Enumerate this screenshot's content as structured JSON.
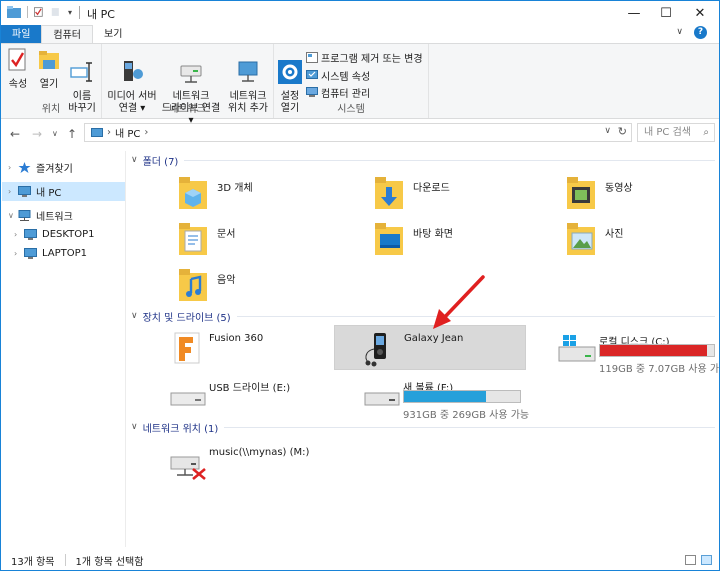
{
  "window": {
    "title": "내 PC",
    "controls": {
      "minimize": "—",
      "maximize": "☐",
      "close": "✕"
    }
  },
  "ribbon_tabs": [
    "파일",
    "컴퓨터",
    "보기"
  ],
  "ribbon_toggle": "∨",
  "help": "?",
  "ribbon": {
    "location": {
      "label": "위치",
      "buttons": [
        {
          "label": "속성",
          "icon": "properties-icon"
        },
        {
          "label": "열기",
          "icon": "open-folder-icon"
        },
        {
          "label": "이름\n바꾸기",
          "icon": "rename-icon"
        }
      ]
    },
    "network": {
      "label": "네트워크",
      "buttons": [
        {
          "label": "미디어 서버\n연결 ▾",
          "icon": "media-server-icon"
        },
        {
          "label": "네트워크\n드라이브 연결 ▾",
          "icon": "map-network-drive-icon"
        },
        {
          "label": "네트워크\n위치 추가",
          "icon": "add-network-location-icon"
        }
      ]
    },
    "system": {
      "label": "시스템",
      "big_button": {
        "label": "설정\n열기",
        "icon": "settings-gear-icon"
      },
      "small_buttons": [
        {
          "label": "프로그램 제거 또는 변경",
          "icon": "uninstall-icon"
        },
        {
          "label": "시스템 속성",
          "icon": "system-properties-icon"
        },
        {
          "label": "컴퓨터 관리",
          "icon": "computer-management-icon"
        }
      ]
    }
  },
  "address": {
    "back": "←",
    "forward": "→",
    "recent": "∨",
    "up": "↑",
    "path": "내 PC",
    "path_sep": "›",
    "dropdown": "∨",
    "refresh": "↻",
    "search_placeholder": "내 PC 검색",
    "search_icon": "⌕"
  },
  "nav_pane": [
    {
      "label": "즐겨찾기",
      "icon": "star-icon",
      "arrow": "›",
      "selected": false
    },
    {
      "label": "내 PC",
      "icon": "pc-icon",
      "arrow": "›",
      "selected": true
    },
    {
      "label": "네트워크",
      "icon": "network-icon",
      "arrow": "∨",
      "selected": false
    },
    {
      "label": "DESKTOP1",
      "icon": "computer-icon",
      "arrow": "›",
      "selected": false
    },
    {
      "label": "LAPTOP1",
      "icon": "computer-icon",
      "arrow": "›",
      "selected": false
    }
  ],
  "sections": {
    "folders": "폴더 (7)",
    "devices": "장치 및 드라이브 (5)",
    "network_locations": "네트워크 위치 (1)"
  },
  "folders": [
    {
      "label": "3D 개체",
      "icon": "3d-objects-folder-icon"
    },
    {
      "label": "다운로드",
      "icon": "downloads-folder-icon"
    },
    {
      "label": "동영상",
      "icon": "videos-folder-icon"
    },
    {
      "label": "문서",
      "icon": "documents-folder-icon"
    },
    {
      "label": "바탕 화면",
      "icon": "desktop-folder-icon"
    },
    {
      "label": "사진",
      "icon": "pictures-folder-icon"
    },
    {
      "label": "음악",
      "icon": "music-folder-icon"
    }
  ],
  "devices": [
    {
      "label": "Fusion 360",
      "icon": "fusion360-icon"
    },
    {
      "label": "Galaxy Jean",
      "icon": "mp3-player-icon",
      "highlighted": true
    },
    {
      "label": "로컬 디스크 (C:)",
      "icon": "windows-drive-icon",
      "usage": "119GB 중 7.07GB 사용 가능",
      "used_fraction": 0.94,
      "bar_color": "#da2626"
    },
    {
      "label": "USB 드라이브 (E:)",
      "icon": "usb-drive-icon"
    },
    {
      "label": "새 볼륨 (F:)",
      "icon": "hard-drive-icon",
      "usage": "931GB 중 269GB 사용 가능",
      "used_fraction": 0.71,
      "bar_color": "#26a0da"
    }
  ],
  "network_locations": [
    {
      "label": "music(\\\\mynas) (M:)",
      "icon": "disconnected-network-drive-icon"
    }
  ],
  "annotation": {
    "icon": "red-arrow-icon",
    "color": "#e02020"
  },
  "status": {
    "item_count": "13개 항목",
    "selection": "1개 항목 선택함"
  },
  "colors": {
    "accent": "#1979ca",
    "selection": "#cce8ff",
    "section_title": "#1e3287",
    "folder": "#f7c948"
  }
}
